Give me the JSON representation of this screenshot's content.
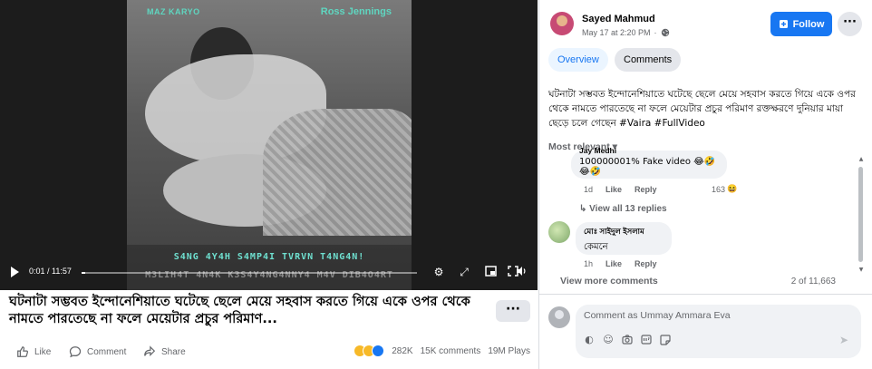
{
  "video": {
    "watermark_left": "MAZ KARYO",
    "watermark_right": "Ross Jennings",
    "caption_line1": "S4NG 4Y4H S4MP4I TVRVN T4NG4N!",
    "caption_line2": "M3LIH4T 4N4K K3S4Y4NG4NNY4 M4V DIB4O4RT",
    "time": "0:01 / 11:57",
    "progress": 0.002
  },
  "post": {
    "title": "ঘটনাটা সম্ভবত ইন্দোনেশিয়াতে ঘটেছে ছেলে মেয়ে সহবাস করতে গিয়ে একে ওপর থেকে নামতে পারতেছে না ফলে মেয়েটার প্রচুর পরিমাণ...",
    "more": "···",
    "like": "Like",
    "comment": "Comment",
    "share": "Share",
    "reactions": "282K",
    "comments_count": "15K comments",
    "plays": "19M Plays"
  },
  "panel": {
    "author": "Sayed Mahmud",
    "date": "May 17 at 2:20 PM",
    "date_sep": "·",
    "follow": "Follow",
    "menu": "···",
    "tab_overview": "Overview",
    "tab_comments": "Comments",
    "caption": "ঘটনাটা সম্ভবত ইন্দোনেশিয়াতে ঘটেছে ছেলে মেয়ে সহবাস করতে গিয়ে একে ওপর থেকে নামতে পারতেছে না ফলে মেয়েটার প্রচুর পরিমাণ রক্তক্ষরণে দুনিয়ার মায়া ছেড়ে চলে গেছেন #Vaira #FullVideo",
    "sort": "Most relevant",
    "comments": [
      {
        "name": "Jay Medhi",
        "text": "100000001% Fake video 😂🤣😂🤣",
        "time": "1d",
        "like": "Like",
        "reply": "Reply",
        "reactions": "163"
      },
      {
        "name": "মোঃ সাইদুল ইসলাম",
        "text": "কেমনে",
        "time": "1h",
        "like": "Like",
        "reply": "Reply"
      }
    ],
    "view_replies": "View all 13 replies",
    "view_more": "View more comments",
    "count": "2 of 11,663",
    "comment_placeholder": "Comment as Ummay Ammara Eva"
  },
  "colors": {
    "accent": "#1877f2",
    "secondary_bg": "#e4e6eb",
    "comment_bg": "#f0f2f5",
    "muted_text": "#65676b"
  },
  "icons": [
    "play-icon",
    "settings-icon",
    "expand-icon",
    "pip-icon",
    "fullscreen-icon",
    "volume-icon",
    "like-icon",
    "comment-icon",
    "share-icon",
    "globe-icon",
    "follow-icon",
    "sticker-icon",
    "emoji-icon",
    "camera-icon",
    "gif-icon",
    "send-icon"
  ]
}
